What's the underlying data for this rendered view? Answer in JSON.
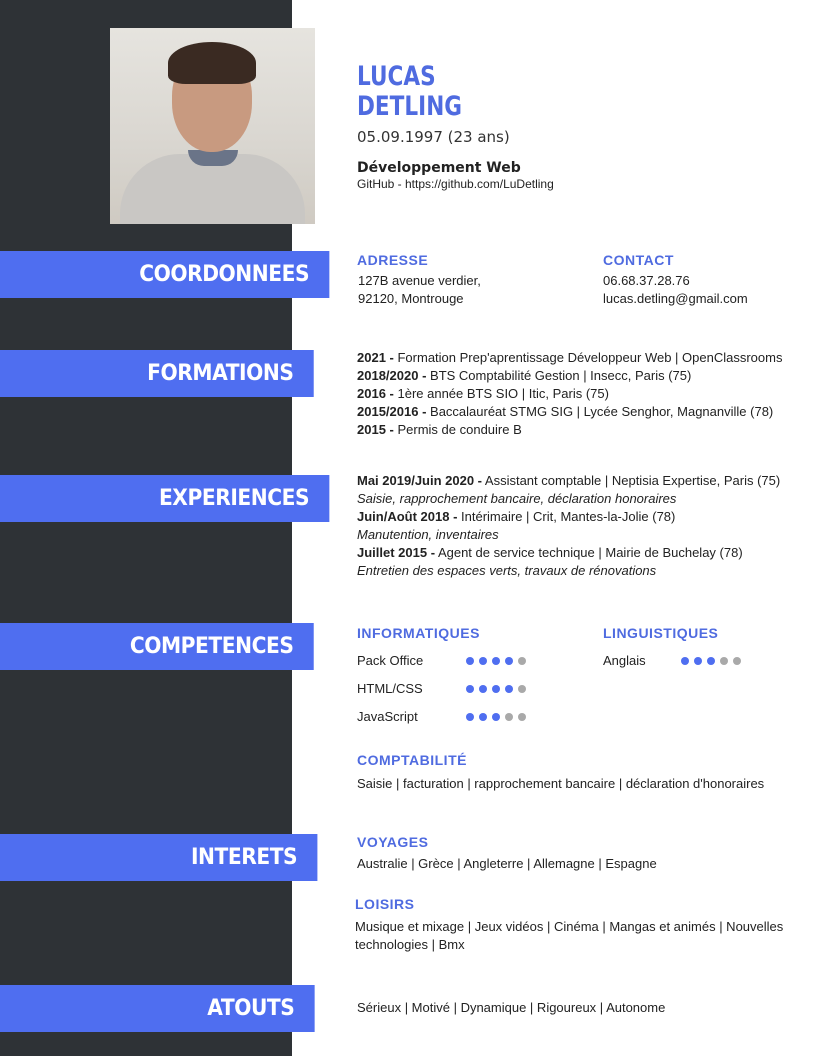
{
  "colors": {
    "sidebar": "#2e3236",
    "accent": "#4f6ef0",
    "heading": "#4f6be0",
    "dot_off": "#a9a9a9"
  },
  "header": {
    "first_name": "LUCAS",
    "last_name": "DETLING",
    "birth": "05.09.1997 (23 ans)",
    "title": "Développement Web",
    "github": "GitHub - https://github.com/LuDetling"
  },
  "sections": {
    "coordonnees": "COORDONNEES",
    "formations": "FORMATIONS",
    "experiences": "EXPERIENCES",
    "competences": "COMPETENCES",
    "interets": "INTERETS",
    "atouts": "ATOUTS"
  },
  "coordonnees": {
    "address_label": "ADRESSE",
    "address_lines": [
      "127B avenue verdier,",
      "92120, Montrouge"
    ],
    "contact_label": "CONTACT",
    "phone": "06.68.37.28.76",
    "email": "lucas.detling@gmail.com"
  },
  "formations": [
    {
      "date": "2021 -",
      "text": " Formation Prep'aprentissage Développeur Web | OpenClassrooms"
    },
    {
      "date": "2018/2020 -",
      "text": " BTS Comptabilité Gestion | Insecc, Paris (75)"
    },
    {
      "date": "2016 -",
      "text": " 1ère année BTS SIO | Itic, Paris (75)"
    },
    {
      "date": "2015/2016 -",
      "text": " Baccalauréat STMG SIG | Lycée Senghor, Magnanville (78)"
    },
    {
      "date": "2015 -",
      "text": " Permis de conduire B"
    }
  ],
  "experiences": [
    {
      "date": "Mai 2019/Juin 2020 -",
      "text": " Assistant comptable | Neptisia Expertise, Paris (75)",
      "desc": "Saisie, rapprochement bancaire, déclaration honoraires"
    },
    {
      "date": "Juin/Août 2018 -",
      "text": " Intérimaire | Crit, Mantes-la-Jolie (78)",
      "desc": "Manutention, inventaires"
    },
    {
      "date": "Juillet 2015 -",
      "text": " Agent de service technique | Mairie de Buchelay (78)",
      "desc": "Entretien des espaces verts, travaux de rénovations"
    }
  ],
  "competences": {
    "informatiques_label": "INFORMATIQUES",
    "informatiques": [
      {
        "name": "Pack Office",
        "level": 4,
        "max": 5
      },
      {
        "name": "HTML/CSS",
        "level": 4,
        "max": 5
      },
      {
        "name": "JavaScript",
        "level": 3,
        "max": 5
      }
    ],
    "linguistiques_label": "LINGUISTIQUES",
    "linguistiques": [
      {
        "name": "Anglais",
        "level": 3,
        "max": 5
      }
    ],
    "comptabilite_label": "COMPTABILITÉ",
    "comptabilite": "Saisie | facturation | rapprochement bancaire | déclaration d'honoraires"
  },
  "interets": {
    "voyages_label": "VOYAGES",
    "voyages": "Australie | Grèce | Angleterre | Allemagne | Espagne",
    "loisirs_label": "LOISIRS",
    "loisirs": "Musique et mixage | Jeux vidéos | Cinéma | Mangas et animés | Nouvelles technologies | Bmx"
  },
  "atouts": "Sérieux | Motivé | Dynamique | Rigoureux | Autonome"
}
